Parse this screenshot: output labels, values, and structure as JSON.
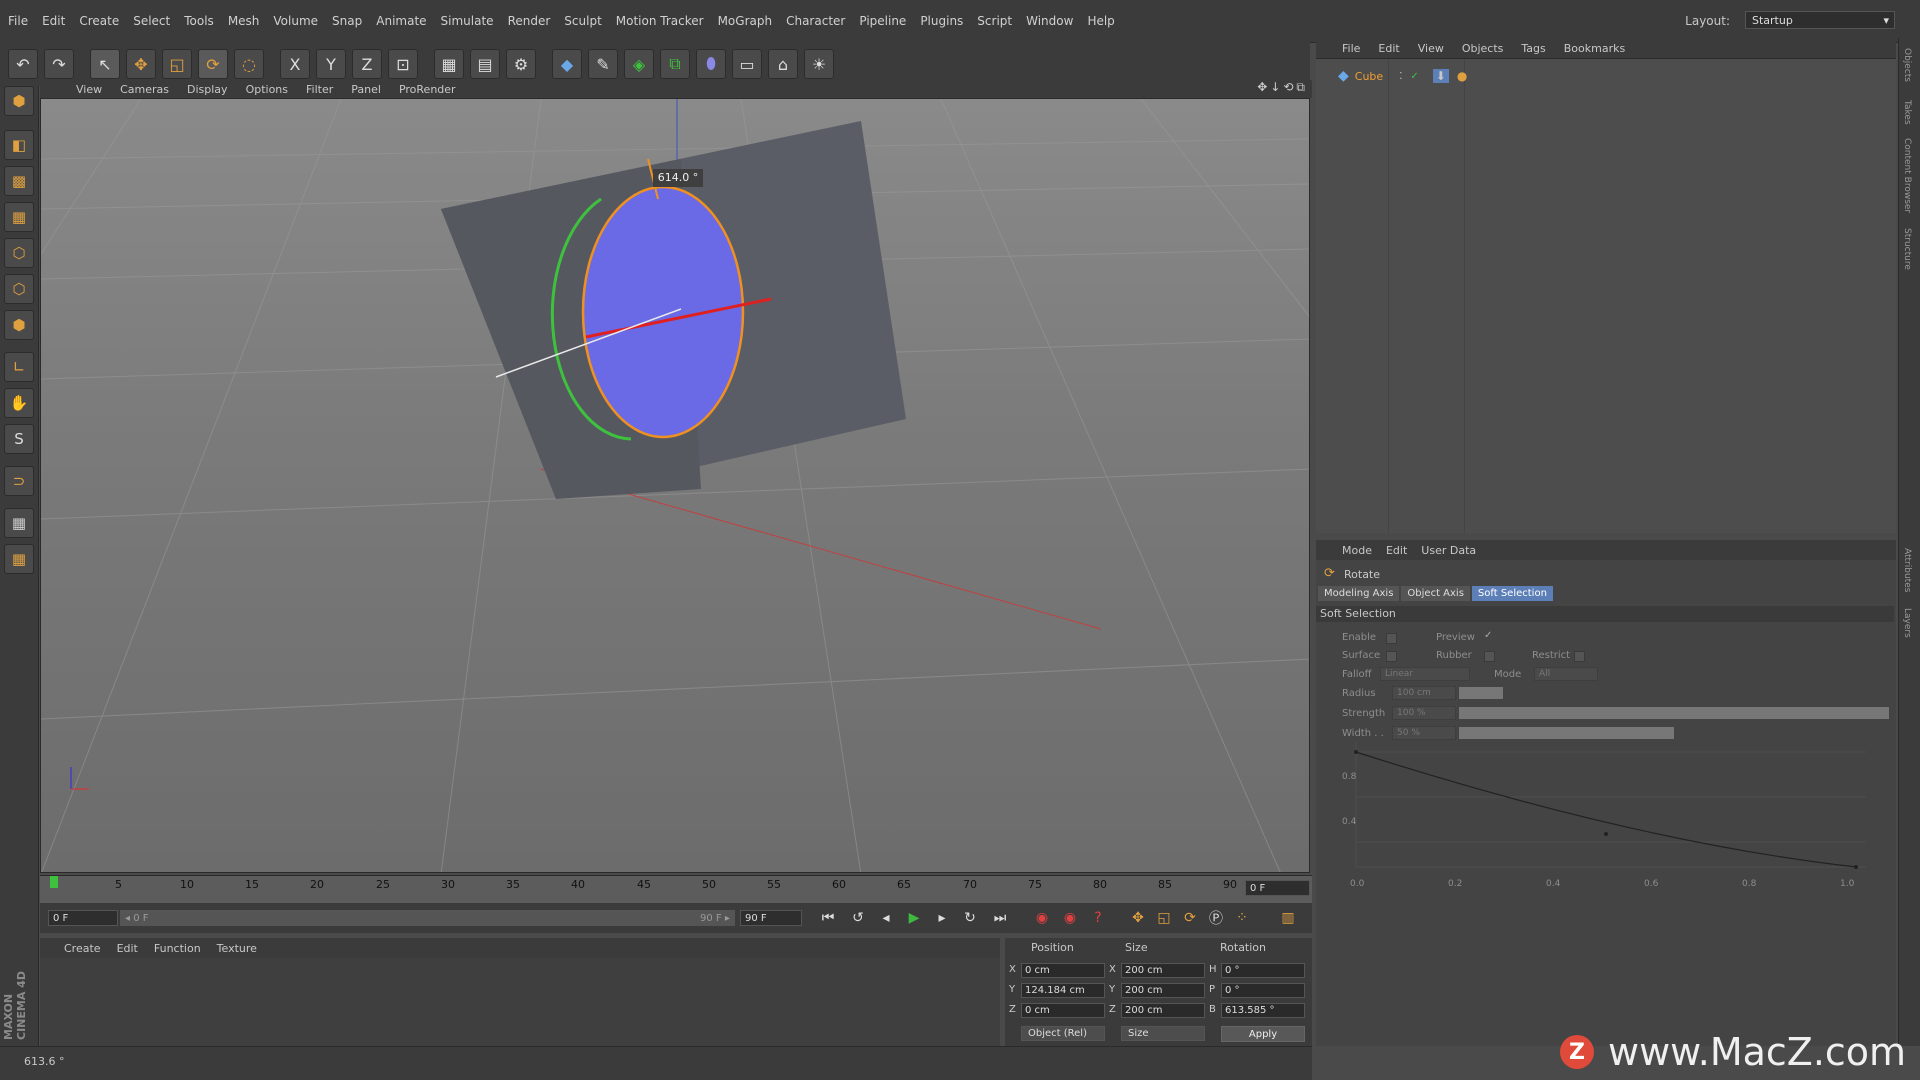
{
  "menubar": {
    "items": [
      "File",
      "Edit",
      "Create",
      "Select",
      "Tools",
      "Mesh",
      "Volume",
      "Snap",
      "Animate",
      "Simulate",
      "Render",
      "Sculpt",
      "Motion Tracker",
      "MoGraph",
      "Character",
      "Pipeline",
      "Plugins",
      "Script",
      "Window",
      "Help"
    ],
    "layout_label": "Layout:",
    "layout_value": "Startup"
  },
  "toolbar": {
    "axis_x": "X",
    "axis_y": "Y",
    "axis_z": "Z"
  },
  "brand": "MAXON CINEMA 4D",
  "viewport": {
    "menu": [
      "View",
      "Cameras",
      "Display",
      "Options",
      "Filter",
      "Panel",
      "ProRender"
    ],
    "nav_icons": "✥↓⟲⧉",
    "rotation_readout": "614.0 °"
  },
  "timeline": {
    "ticks": [
      "0",
      "5",
      "10",
      "15",
      "20",
      "25",
      "30",
      "35",
      "40",
      "45",
      "50",
      "55",
      "60",
      "65",
      "70",
      "75",
      "80",
      "85",
      "90"
    ],
    "end_field": "0 F"
  },
  "transport": {
    "current_frame": "0 F",
    "range_start": "◂ 0 F",
    "range_end": "90 F ▸",
    "max_frame": "90 F"
  },
  "material_manager": {
    "menu": [
      "Create",
      "Edit",
      "Function",
      "Texture"
    ]
  },
  "coordinates": {
    "headers": [
      "Position",
      "Size",
      "Rotation"
    ],
    "rows": [
      {
        "axis": "X",
        "pos": "0 cm",
        "size_axis": "X",
        "size": "200 cm",
        "rot_axis": "H",
        "rot": "0 °"
      },
      {
        "axis": "Y",
        "pos": "124.184 cm",
        "size_axis": "Y",
        "size": "200 cm",
        "rot_axis": "P",
        "rot": "0 °"
      },
      {
        "axis": "Z",
        "pos": "0 cm",
        "size_axis": "Z",
        "size": "200 cm",
        "rot_axis": "B",
        "rot": "613.585 °"
      }
    ],
    "mode_dropdown": "Object (Rel)",
    "size_dropdown": "Size",
    "apply": "Apply"
  },
  "statusbar": {
    "text": "613.6 °"
  },
  "object_manager": {
    "menu": [
      "File",
      "Edit",
      "View",
      "Objects",
      "Tags",
      "Bookmarks"
    ],
    "object_name": "Cube"
  },
  "right_tabs": [
    "Objects",
    "Takes",
    "Content Browser",
    "Structure",
    "Attributes",
    "Layers"
  ],
  "attributes": {
    "menu": [
      "Mode",
      "Edit",
      "User Data"
    ],
    "tool_title": "Rotate",
    "tabs": [
      "Modeling Axis",
      "Object Axis",
      "Soft Selection"
    ],
    "section": "Soft Selection",
    "labels": {
      "enable": "Enable",
      "preview": "Preview",
      "surface": "Surface",
      "rubber": "Rubber",
      "restrict": "Restrict",
      "falloff": "Falloff",
      "mode": "Mode",
      "radius": "Radius",
      "strength": "Strength",
      "width": "Width . ."
    },
    "values": {
      "falloff": "Linear",
      "mode": "All",
      "radius": "100 cm",
      "strength": "100 %",
      "width": "50 %"
    },
    "strength_fraction": 1.0,
    "width_fraction": 0.5,
    "graph_y_ticks": [
      "0.8",
      "0.4"
    ],
    "graph_x_ticks": [
      "0.0",
      "0.2",
      "0.4",
      "0.6",
      "0.8",
      "1.0"
    ]
  },
  "watermark": {
    "logo_letter": "Z",
    "text": "www.MacZ.com"
  },
  "colors": {
    "accent_selected_tab": "#5d7fb8",
    "cube": "#5a5d66",
    "handle_blue": "#6a6ae6",
    "handle_green": "#3ec23e",
    "handle_orange": "#f09020",
    "handle_red": "#e02020"
  }
}
